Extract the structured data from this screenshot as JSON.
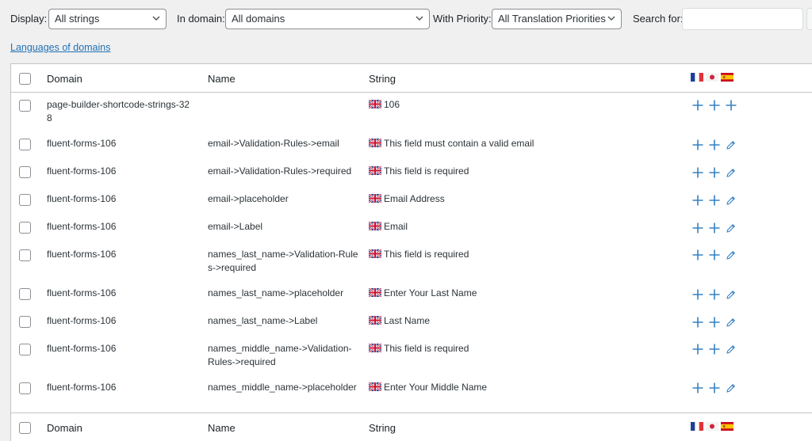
{
  "filters": {
    "display_label": "Display:",
    "display_value": "All strings",
    "domain_label": "In domain:",
    "domain_value": "All domains",
    "priority_label": "With Priority:",
    "priority_value": "All Translation Priorities",
    "search_label": "Search for:",
    "search_value": ""
  },
  "languages_link": "Languages of domains",
  "columns": {
    "domain": "Domain",
    "name": "Name",
    "string": "String"
  },
  "languages": [
    "fr",
    "ja",
    "es"
  ],
  "rows": [
    {
      "domain": "page-builder-shortcode-strings-328",
      "name": "",
      "string": "106",
      "status": [
        "add",
        "add",
        "add"
      ]
    },
    {
      "domain": "fluent-forms-106",
      "name": "email->Validation-Rules->email",
      "string": "This field must contain a valid email",
      "status": [
        "add",
        "add",
        "edit"
      ]
    },
    {
      "domain": "fluent-forms-106",
      "name": "email->Validation-Rules->required",
      "string": "This field is required",
      "status": [
        "add",
        "add",
        "edit"
      ]
    },
    {
      "domain": "fluent-forms-106",
      "name": "email->placeholder",
      "string": "Email Address",
      "status": [
        "add",
        "add",
        "edit"
      ]
    },
    {
      "domain": "fluent-forms-106",
      "name": "email->Label",
      "string": "Email",
      "status": [
        "add",
        "add",
        "edit"
      ]
    },
    {
      "domain": "fluent-forms-106",
      "name": "names_last_name->Validation-Rules->required",
      "string": "This field is required",
      "status": [
        "add",
        "add",
        "edit"
      ]
    },
    {
      "domain": "fluent-forms-106",
      "name": "names_last_name->placeholder",
      "string": "Enter Your Last Name",
      "status": [
        "add",
        "add",
        "edit"
      ]
    },
    {
      "domain": "fluent-forms-106",
      "name": "names_last_name->Label",
      "string": "Last Name",
      "status": [
        "add",
        "add",
        "edit"
      ]
    },
    {
      "domain": "fluent-forms-106",
      "name": "names_middle_name->Validation-Rules->required",
      "string": "This field is required",
      "status": [
        "add",
        "add",
        "edit"
      ]
    },
    {
      "domain": "fluent-forms-106",
      "name": "names_middle_name->placeholder",
      "string": "Enter Your Middle Name",
      "status": [
        "add",
        "add",
        "edit"
      ]
    }
  ],
  "colors": {
    "accent": "#2271b1",
    "icon": "#3582c4"
  }
}
